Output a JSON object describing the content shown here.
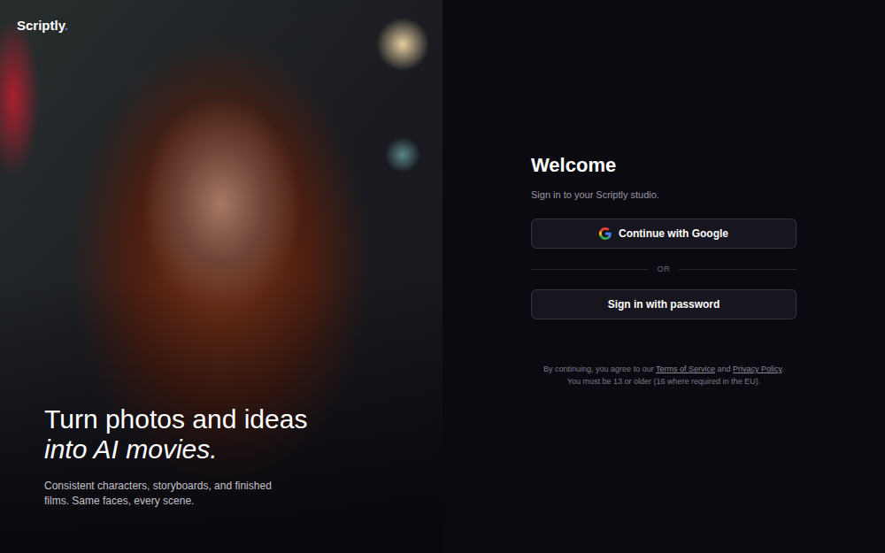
{
  "logo": {
    "text": "Scriptly",
    "dot": "."
  },
  "hero": {
    "headline": "Turn photos and ideas",
    "headline_em": "into AI movies.",
    "tagline": "Consistent characters, storyboards, and finished films. Same faces, every scene."
  },
  "signin": {
    "title": "Welcome",
    "subtitle": "Sign in to your Scriptly studio.",
    "google_button": "Continue with Google",
    "divider": "OR",
    "password_button": "Sign in with password",
    "legal": {
      "before": "By continuing, you agree to our ",
      "terms": "Terms of Service",
      "middle": " and ",
      "privacy": "Privacy Policy",
      "after": ".",
      "age": "You must be 13 or older (16 where required in the EU)."
    }
  }
}
